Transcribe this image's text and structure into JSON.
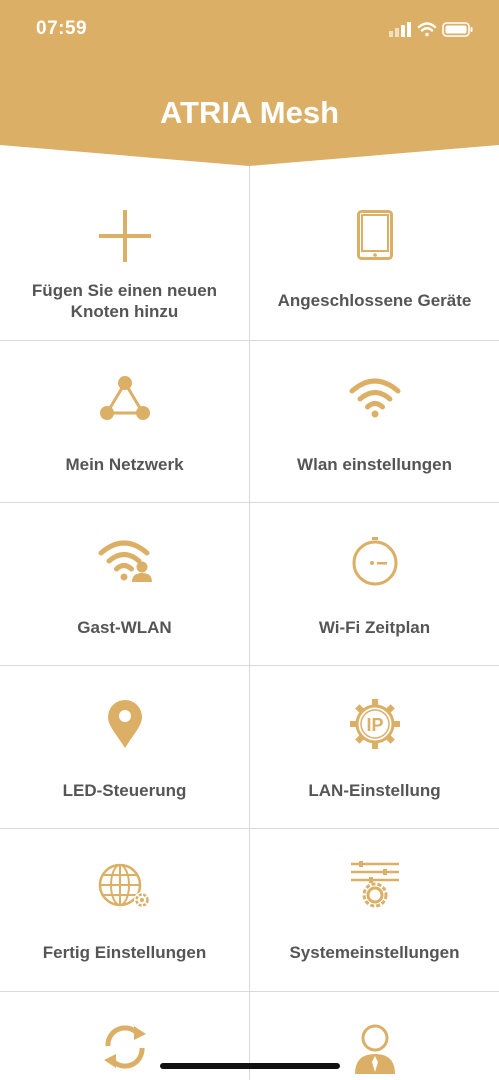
{
  "status": {
    "time": "07:59"
  },
  "header": {
    "title": "ATRIA Mesh"
  },
  "colors": {
    "accent": "#dbaf66",
    "text": "#555555",
    "divider": "#d9d9d9"
  },
  "menu": [
    {
      "label": "Fügen Sie einen neuen Knoten hinzu",
      "icon": "plus-icon"
    },
    {
      "label": "Angeschlossene Geräte",
      "icon": "tablet-icon"
    },
    {
      "label": "Mein Netzwerk",
      "icon": "network-triangle-icon"
    },
    {
      "label": "Wlan einstellungen",
      "icon": "wifi-icon"
    },
    {
      "label": "Gast-WLAN",
      "icon": "guest-wifi-icon"
    },
    {
      "label": "Wi-Fi Zeitplan",
      "icon": "timer-icon"
    },
    {
      "label": "LED-Steuerung",
      "icon": "location-pin-icon"
    },
    {
      "label": "LAN-Einstellung",
      "icon": "ip-gear-icon"
    },
    {
      "label": "Fertig Einstellungen",
      "icon": "globe-gear-icon"
    },
    {
      "label": "Systemeinstellungen",
      "icon": "system-settings-icon"
    },
    {
      "label": "",
      "icon": "sync-icon"
    },
    {
      "label": "",
      "icon": "user-icon"
    }
  ]
}
